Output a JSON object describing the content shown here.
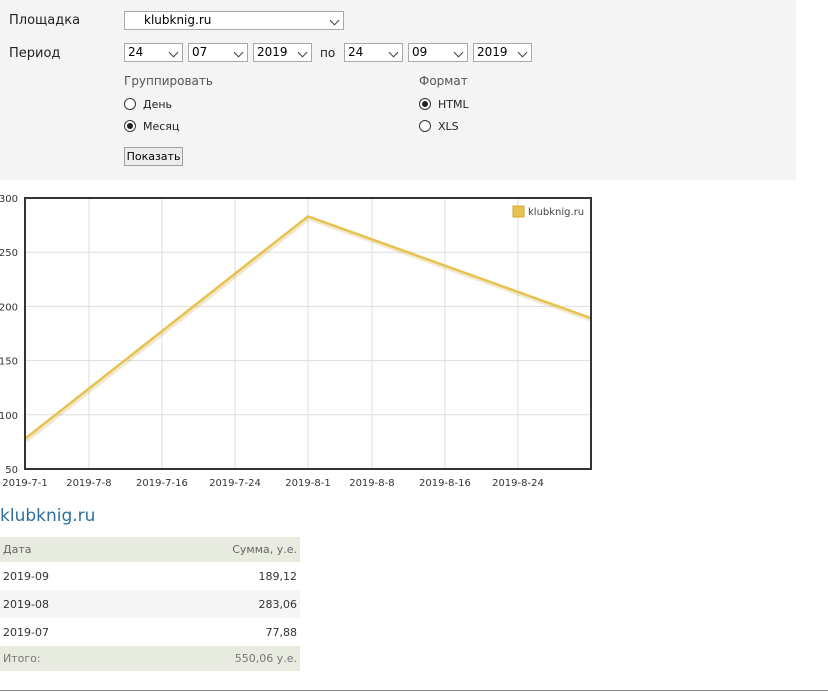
{
  "form": {
    "site_label": "Площадка",
    "site_value": "klubknig.ru",
    "period_label": "Период",
    "from_day": "24",
    "from_month": "07",
    "from_year": "2019",
    "to_label": "по",
    "to_day": "24",
    "to_month": "09",
    "to_year": "2019",
    "group_title": "Группировать",
    "group_options": [
      "День",
      "Месяц"
    ],
    "group_selected": "Месяц",
    "format_title": "Формат",
    "format_options": [
      "HTML",
      "XLS"
    ],
    "format_selected": "HTML",
    "show_button": "Показать"
  },
  "chart_data": {
    "type": "line",
    "x": [
      "2019-07-01",
      "2019-08-01",
      "2019-09-01"
    ],
    "series": [
      {
        "name": "klubknig.ru",
        "values": [
          77.88,
          283.06,
          189.12
        ],
        "color": "#e8c250"
      }
    ],
    "yticks": [
      50,
      100,
      150,
      200,
      250,
      300
    ],
    "ytick_labels": [
      "50",
      "100",
      "150",
      "200",
      "250",
      "300"
    ],
    "xticks": [
      "2019-07-01",
      "2019-07-08",
      "2019-07-16",
      "2019-07-24",
      "2019-08-01",
      "2019-08-08",
      "2019-08-16",
      "2019-08-24"
    ],
    "xtick_labels": [
      "2019-7-1",
      "2019-7-8",
      "2019-7-16",
      "2019-7-24",
      "2019-8-1",
      "2019-8-8",
      "2019-8-16",
      "2019-8-24"
    ],
    "xlim": [
      "2019-07-01",
      "2019-09-01"
    ],
    "ylim": [
      50,
      300
    ],
    "grid": true,
    "legend": "top-right"
  },
  "report": {
    "title": "klubknig.ru",
    "col_date": "Дата",
    "col_sum": "Сумма, у.е.",
    "rows": [
      {
        "date": "2019-09",
        "sum": "189,12"
      },
      {
        "date": "2019-08",
        "sum": "283,06"
      },
      {
        "date": "2019-07",
        "sum": "77,88"
      }
    ],
    "total_label": "Итого:",
    "total_value": "550,06 у.е."
  }
}
